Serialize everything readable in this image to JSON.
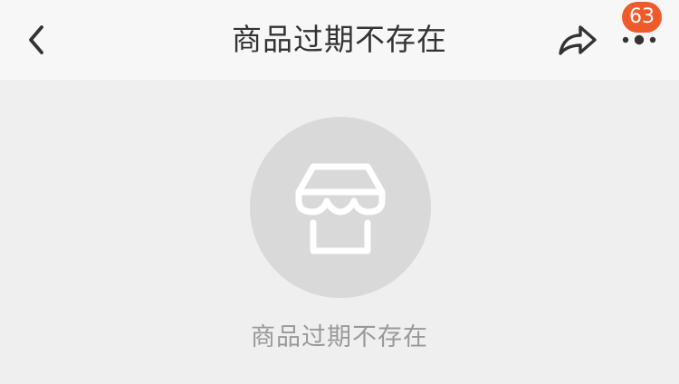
{
  "header": {
    "title": "商品过期不存在",
    "back_icon": "chevron-left-icon",
    "share_icon": "share-icon",
    "more_icon": "more-icon",
    "badge_count": "63",
    "badge_color": "#ee5a2a"
  },
  "empty_state": {
    "icon": "storefront-icon",
    "message": "商品过期不存在",
    "circle_color": "#d9d9d9",
    "text_color": "#999999"
  }
}
